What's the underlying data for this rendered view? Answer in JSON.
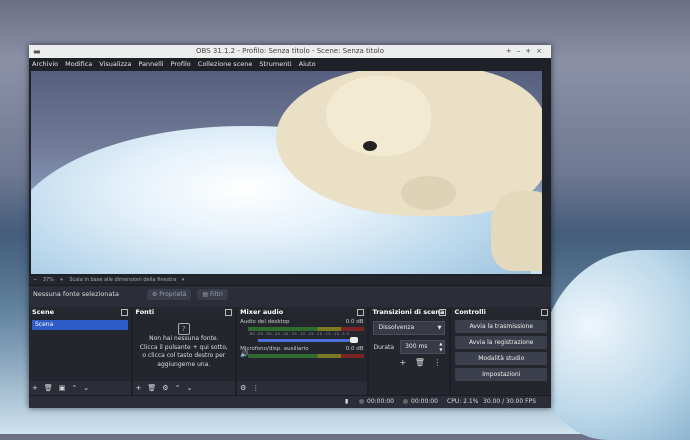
{
  "window": {
    "title": "OBS 31.1.2 - Profilo: Senza titolo - Scene: Senza titolo"
  },
  "menu": [
    "Archivio",
    "Modifica",
    "Visualizza",
    "Pannelli",
    "Profilo",
    "Collezione scene",
    "Strumenti",
    "Aiuto"
  ],
  "preview": {
    "zoom": "37%",
    "scale_label": "Scala in base alle dimensioni della finestra"
  },
  "source_toolbar": {
    "status": "Nessuna fonte selezionata",
    "properties": "Proprietà",
    "filters": "Filtri"
  },
  "scenes": {
    "title": "Scene",
    "items": [
      "Scena"
    ]
  },
  "sources": {
    "title": "Fonti",
    "empty_line1": "Non hai nessuna fonte.",
    "empty_line2": "Clicca il pulsante + qui sotto,",
    "empty_line3": "o clicca col tasto destro per",
    "empty_line4": "aggiungerne una."
  },
  "mixer": {
    "title": "Mixer audio",
    "channels": [
      {
        "name": "Audio del desktop",
        "db": "0.0 dB"
      },
      {
        "name": "Microfono/disp. ausiliario",
        "db": "0.0 dB"
      }
    ],
    "ticks": "-60 -55 -50 -45 -40 -35 -30 -25 -20 -15 -10 -5 0"
  },
  "transitions": {
    "title": "Transizioni di scena",
    "selected": "Dissolvenza",
    "duration_label": "Durata",
    "duration_value": "300 ms"
  },
  "controls": {
    "title": "Controlli",
    "buttons": [
      "Avvia la trasmissione",
      "Avvia la registrazione",
      "Modalità studio",
      "Impostazioni"
    ]
  },
  "status": {
    "stream_time": "00:00:00",
    "rec_time": "00:00:00",
    "cpu": "CPU: 2.1%",
    "fps": "30.00 / 30.00 FPS"
  }
}
